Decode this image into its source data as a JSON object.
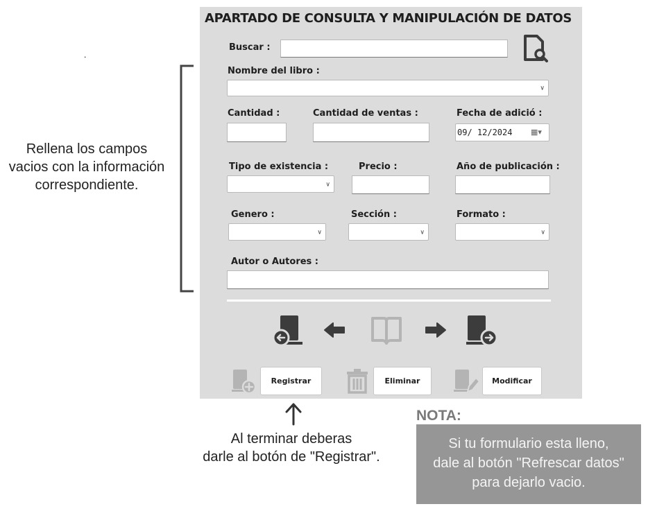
{
  "title": "APARTADO DE CONSULTA Y MANIPULACIÓN DE DATOS",
  "search": {
    "label": "Buscar :",
    "value": ""
  },
  "fields": {
    "nombre_libro": "Nombre del libro :",
    "cantidad": "Cantidad :",
    "cantidad_ventas": "Cantidad de ventas :",
    "fecha": "Fecha de adició :",
    "fecha_value": "09/ 12/2024",
    "tipo_existencia": "Tipo de existencia :",
    "precio": "Precio :",
    "anio_publicacion": "Año de publicación :",
    "genero": "Genero :",
    "seccion": "Sección :",
    "formato": "Formato :",
    "autor": "Autor o Autores :"
  },
  "buttons": {
    "registrar": "Registrar",
    "eliminar": "Eliminar",
    "modificar": "Modificar"
  },
  "annotations": {
    "left_line1": "Rellena los campos",
    "left_line2": "vacios con la información",
    "left_line3": "correspondiente.",
    "bottom_line1": "Al terminar deberas",
    "bottom_line2": "darle al botón de \"Registrar\".",
    "nota_title": "NOTA:",
    "nota_line1": "Si tu formulario esta lleno,",
    "nota_line2": "dale al botón \"Refrescar datos\"",
    "nota_line3": "para dejarlo vacio.",
    "dot": "."
  },
  "icons": [
    "search-document-icon",
    "book-prev-icon",
    "arrow-left-icon",
    "open-book-icon",
    "arrow-right-icon",
    "book-next-icon",
    "book-add-icon",
    "trash-icon",
    "book-edit-icon",
    "arrow-up-icon"
  ],
  "colors": {
    "panel": "#dcdcdc",
    "icon": "#3c3c3c",
    "icon_light": "#b4b4b4",
    "nota_bg": "#969696"
  }
}
